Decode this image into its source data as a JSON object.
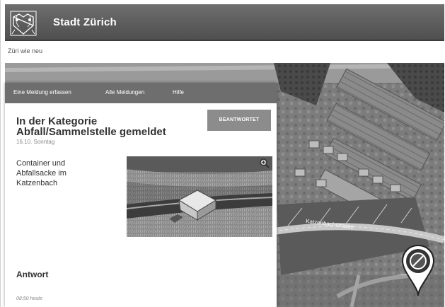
{
  "header": {
    "site_title": "Stadt Zürich",
    "logo": "zurich-coat-of-arms-icon"
  },
  "tagline": "Züri wie neu",
  "nav": {
    "items": [
      {
        "label": "Eine Meldung erfassen"
      },
      {
        "label": "Alle Meldungen"
      },
      {
        "label": "Hilfe"
      }
    ]
  },
  "report": {
    "heading_line1": "In der Kategorie",
    "heading_line2": "Abfall/Sammelstelle gemeldet",
    "date": "16.10. Sonntag",
    "status": "BEANTWORTET",
    "description_lines": [
      "Container und",
      "Abfallsacke im",
      "Katzenbach"
    ],
    "photo_icon": "zoom-icon",
    "answer_heading": "Antwort",
    "answer_time": "08:50 heute"
  },
  "map": {
    "street_label": "Katzenbachstrasse",
    "marker_icon": "map-pin-icon"
  },
  "colors": {
    "header_bg": "#5e5e5e",
    "nav_bg": "#6e6e6e",
    "badge_bg": "#8c8c8c"
  }
}
